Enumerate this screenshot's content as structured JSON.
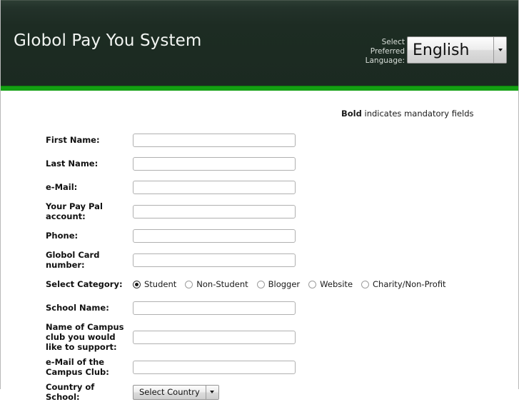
{
  "header": {
    "title": "Globol Pay You System",
    "language_label_lines": [
      "Select",
      "Preferred",
      "Language:"
    ],
    "language_selected": "English",
    "accent_green": "#14a013",
    "background": "#1c2b22"
  },
  "content": {
    "mandatory_note_bold": "Bold",
    "mandatory_note_rest": " indicates mandatory fields"
  },
  "form": {
    "fields": [
      {
        "label": "First Name:",
        "value": "",
        "placeholder": ""
      },
      {
        "label": "Last Name:",
        "value": "",
        "placeholder": ""
      },
      {
        "label": "e-Mail:",
        "value": "",
        "placeholder": ""
      },
      {
        "label": "Your Pay Pal account:",
        "value": "",
        "placeholder": ""
      },
      {
        "label": "Phone:",
        "value": "",
        "placeholder": ""
      },
      {
        "label": "Globol Card number:",
        "value": "",
        "placeholder": ""
      }
    ],
    "category": {
      "label": "Select Category:",
      "options": [
        {
          "label": "Student",
          "selected": true
        },
        {
          "label": "Non-Student",
          "selected": false
        },
        {
          "label": "Blogger",
          "selected": false
        },
        {
          "label": "Website",
          "selected": false
        },
        {
          "label": "Charity/Non-Profit",
          "selected": false
        }
      ]
    },
    "school_fields": [
      {
        "label": "School Name:",
        "value": "",
        "placeholder": ""
      },
      {
        "label": "Name of Campus club you would like to support:",
        "value": "",
        "placeholder": ""
      },
      {
        "label": "e-Mail of the Campus Club:",
        "value": "",
        "placeholder": ""
      }
    ],
    "country": {
      "label": "Country of School:",
      "selected": "Select Country"
    }
  }
}
